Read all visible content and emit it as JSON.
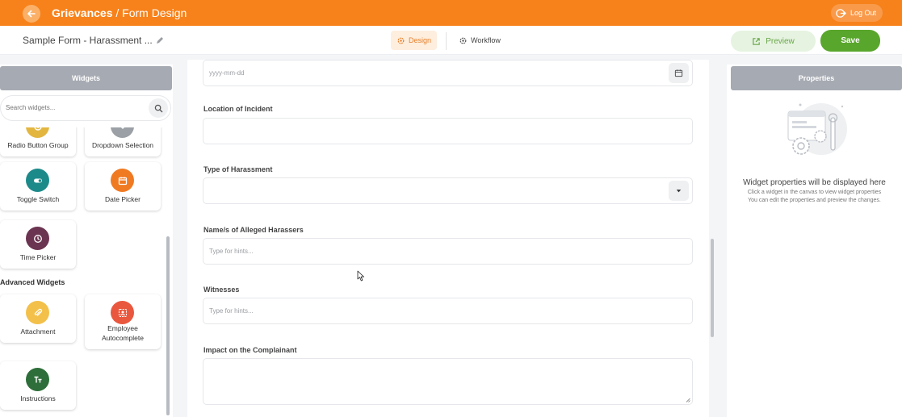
{
  "app": {
    "title": "Grievances",
    "separator": " / ",
    "subtitle": "Form Design",
    "logout_label": "Log Out"
  },
  "subheader": {
    "form_name": "Sample Form - Harassment ...",
    "tabs": [
      {
        "label": "Design",
        "active": true
      },
      {
        "label": "Workflow",
        "active": false
      }
    ],
    "preview_label": "Preview",
    "save_label": "Save"
  },
  "widgets_panel": {
    "title": "Widgets",
    "search_placeholder": "Search widgets...",
    "basic_items": [
      {
        "label": "Radio Button Group",
        "icon": "radio-icon",
        "color": "#e3b640"
      },
      {
        "label": "Dropdown Selection",
        "icon": "dropdown-icon",
        "color": "#9aa0a6"
      },
      {
        "label": "Toggle Switch",
        "icon": "toggle-icon",
        "color": "#1d8a8a"
      },
      {
        "label": "Date Picker",
        "icon": "calendar-icon",
        "color": "#f07a22"
      },
      {
        "label": "Time Picker",
        "icon": "clock-icon",
        "color": "#6b3450"
      }
    ],
    "advanced_title": "Advanced Widgets",
    "advanced_items": [
      {
        "label": "Attachment",
        "icon": "paperclip-icon",
        "color": "#f3c04a"
      },
      {
        "label": "Employee Autocomplete",
        "icon": "employee-icon",
        "color": "#e9573f"
      },
      {
        "label": "Instructions",
        "icon": "text-format-icon",
        "color": "#2d6e3a"
      }
    ]
  },
  "form_canvas": {
    "date_field": {
      "placeholder": "yyyy-mm-dd"
    },
    "fields": [
      {
        "label": "Location of Incident",
        "placeholder": ""
      },
      {
        "label": "Type of Harassment",
        "placeholder": ""
      },
      {
        "label": "Name/s of Alleged Harassers",
        "placeholder": "Type for hints..."
      },
      {
        "label": "Witnesses",
        "placeholder": "Type for hints..."
      },
      {
        "label": "Impact on the Complainant",
        "placeholder": ""
      }
    ]
  },
  "properties_panel": {
    "title": "Properties",
    "empty_title": "Widget properties will be displayed here",
    "empty_line1": "Click a widget in the canvas to view widget properties",
    "empty_line2": "You can edit the properties and preview the changes."
  },
  "colors": {
    "brand_orange": "#f7821b",
    "save_green": "#59a62c",
    "panel_header_gray": "#a6aab2"
  }
}
